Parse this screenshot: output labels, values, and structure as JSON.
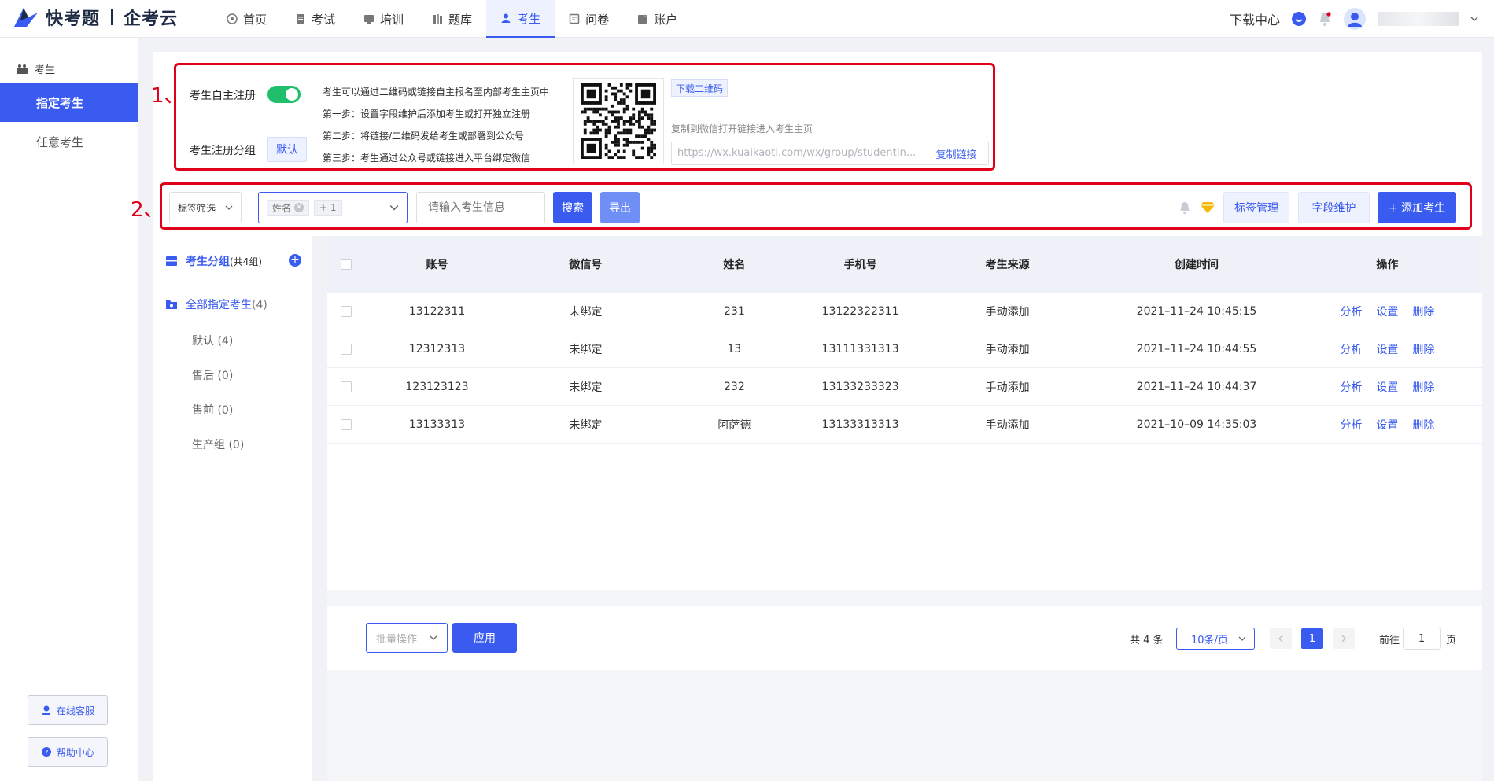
{
  "brand": {
    "name": "快考题",
    "sub_name": "企考云"
  },
  "nav": {
    "items": [
      {
        "label": "首页",
        "icon": "home-icon"
      },
      {
        "label": "考试",
        "icon": "exam-icon"
      },
      {
        "label": "培训",
        "icon": "training-icon"
      },
      {
        "label": "题库",
        "icon": "question-bank-icon"
      },
      {
        "label": "考生",
        "icon": "user-icon",
        "active": true
      },
      {
        "label": "问卷",
        "icon": "survey-icon"
      },
      {
        "label": "账户",
        "icon": "account-icon"
      }
    ],
    "download_center": "下载中心"
  },
  "sidebar": {
    "section": "考生",
    "items": [
      {
        "label": "指定考生",
        "active": true
      },
      {
        "label": "任意考生"
      }
    ],
    "online_service": "在线客服",
    "help_center": "帮助中心"
  },
  "annotations": {
    "box1": "1、",
    "box2": "2、"
  },
  "register": {
    "self_register_label": "考生自主注册",
    "self_register_enabled": true,
    "group_label": "考生注册分组",
    "group_value": "默认",
    "steps": [
      "考生可以通过二维码或链接自主报名至内部考生主页中",
      "第一步：设置字段维护后添加考生或打开独立注册",
      "第二步：将链接/二维码发给考生或部署到公众号",
      "第三步：考生通过公众号或链接进入平台绑定微信"
    ],
    "download_qr": "下载二维码",
    "copy_hint": "复制到微信打开链接进入考生主页",
    "link_value": "https://wx.kuaikaoti.com/wx/group/studentIn...",
    "copy_link": "复制链接"
  },
  "toolbar": {
    "tag_filter": "标签筛选",
    "field_chip": "姓名",
    "field_more": "+ 1",
    "search_placeholder": "请输入考生信息",
    "search": "搜索",
    "export": "导出",
    "tag_manage": "标签管理",
    "field_maintain": "字段维护",
    "add_student": "+ 添加考生"
  },
  "groups": {
    "title": "考生分组",
    "title_count": "(共4组)",
    "all_label": "全部指定考生",
    "all_count": "(4)",
    "items": [
      {
        "label": "默认 (4)"
      },
      {
        "label": "售后 (0)"
      },
      {
        "label": "售前 (0)"
      },
      {
        "label": "生产组 (0)"
      }
    ]
  },
  "table": {
    "headers": {
      "account": "账号",
      "wechat": "微信号",
      "name": "姓名",
      "phone": "手机号",
      "source": "考生来源",
      "created": "创建时间",
      "ops": "操作"
    },
    "op_labels": {
      "analyze": "分析",
      "settings": "设置",
      "delete": "删除"
    },
    "rows": [
      {
        "account": "13122311",
        "wechat": "未绑定",
        "name": "231",
        "phone": "13122322311",
        "source": "手动添加",
        "created": "2021–11–24 10:45:15"
      },
      {
        "account": "12312313",
        "wechat": "未绑定",
        "name": "13",
        "phone": "13111331313",
        "source": "手动添加",
        "created": "2021–11–24 10:44:55"
      },
      {
        "account": "123123123",
        "wechat": "未绑定",
        "name": "232",
        "phone": "13133233323",
        "source": "手动添加",
        "created": "2021–11–24 10:44:37"
      },
      {
        "account": "13133313",
        "wechat": "未绑定",
        "name": "阿萨德",
        "phone": "13133313313",
        "source": "手动添加",
        "created": "2021–10–09 14:35:03"
      }
    ]
  },
  "footer": {
    "batch_placeholder": "批量操作",
    "apply": "应用",
    "total": "共 4 条",
    "page_size": "10条/页",
    "current_page": "1",
    "goto_label": "前往",
    "goto_value": "1",
    "goto_suffix": "页"
  },
  "colors": {
    "primary": "#3a5bf0",
    "toggle_on": "#1fbf6b",
    "annotation": "#e0001a"
  }
}
